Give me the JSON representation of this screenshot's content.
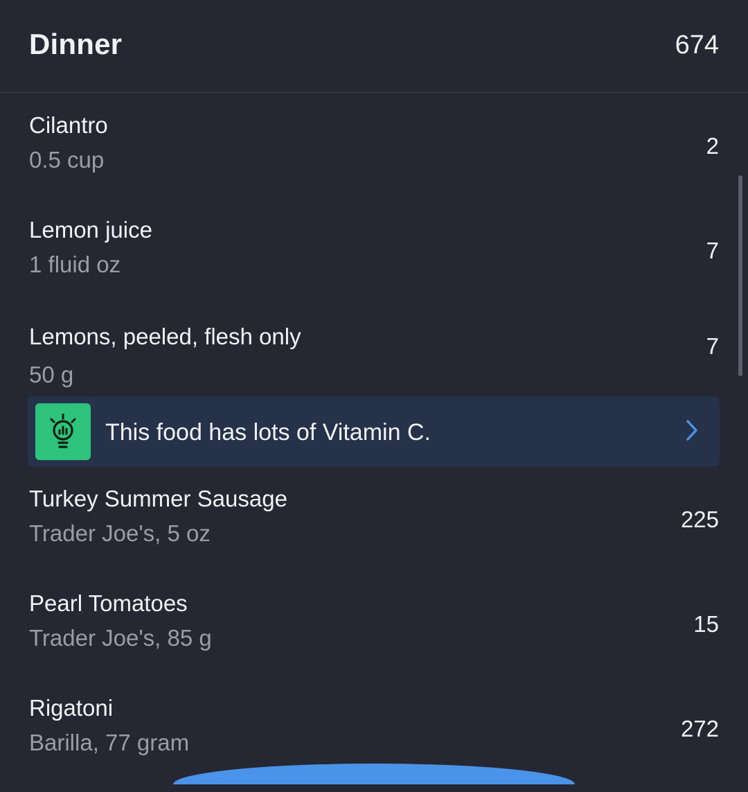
{
  "meal": {
    "title": "Dinner",
    "total_calories": "674"
  },
  "foods": [
    {
      "name": "Cilantro",
      "detail": "0.5 cup",
      "calories": "2"
    },
    {
      "name": "Lemon juice",
      "detail": "1 fluid oz",
      "calories": "7"
    },
    {
      "name": "Lemons, peeled, flesh only",
      "detail": "50 g",
      "calories": "7"
    },
    {
      "name": "Turkey Summer Sausage",
      "detail": "Trader Joe's, 5 oz",
      "calories": "225"
    },
    {
      "name": "Pearl Tomatoes",
      "detail": "Trader Joe's, 85 g",
      "calories": "15"
    },
    {
      "name": "Rigatoni",
      "detail": "Barilla, 77 gram",
      "calories": "272"
    }
  ],
  "tip": {
    "text": "This food has lots of Vitamin C.",
    "icon": "lightbulb-icon",
    "icon_bg_color": "#2ec37a",
    "chevron_color": "#4b93e8"
  },
  "colors": {
    "background": "#252733",
    "secondary_text": "#9a9ca6",
    "tip_background": "#26314a",
    "accent": "#4b93e8"
  }
}
